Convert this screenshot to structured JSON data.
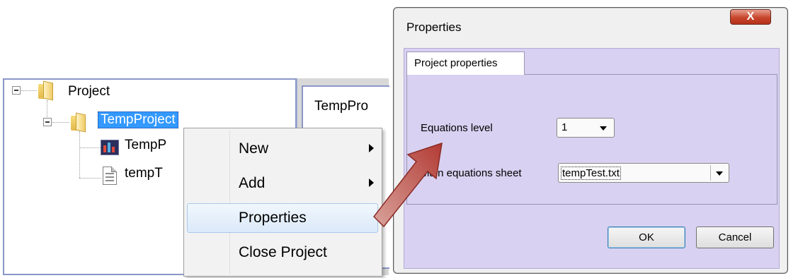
{
  "tree": {
    "project_label": "Project",
    "temp_project_label": "TempProject",
    "child1_label": "TempP",
    "child2_label": "tempT"
  },
  "doc_panel": {
    "tab_label": "TempPro"
  },
  "context_menu": {
    "items": [
      {
        "label": "New",
        "has_submenu": true
      },
      {
        "label": "Add",
        "has_submenu": true
      },
      {
        "label": "Properties",
        "has_submenu": false
      },
      {
        "label": "Close Project",
        "has_submenu": false
      }
    ],
    "hovered": "Properties"
  },
  "dialog": {
    "title": "Properties",
    "close_glyph": "X",
    "tab_label": "Project properties",
    "equations_level_label": "Equations level",
    "equations_level_value": "1",
    "main_sheet_label": "Main equations sheet",
    "main_sheet_value": "tempTest.txt",
    "ok_label": "OK",
    "cancel_label": "Cancel"
  },
  "colors": {
    "dialog_body": "#d8d1f1",
    "selection": "#3399ff",
    "arrow": "#b9413a",
    "close_button": "#c7462c"
  }
}
